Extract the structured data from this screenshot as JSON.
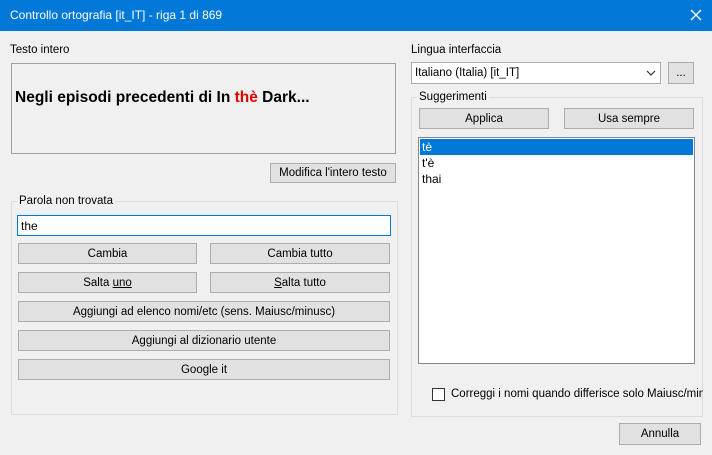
{
  "window": {
    "title": "Controllo ortografia [it_IT] - riga 1 di 869"
  },
  "full_text": {
    "label": "Testo intero",
    "before": "Negli episodi precedenti di In ",
    "error_word": "thè",
    "after": " Dark..."
  },
  "edit_full_text_label": "Modifica l'intero testo",
  "interface_language": {
    "label": "Lingua interfaccia",
    "selected": "Italiano (Italia) [it_IT]",
    "more_label": "..."
  },
  "suggestions": {
    "group_label": "Suggerimenti",
    "apply_label": "Applica",
    "always_use_label": "Usa sempre",
    "items": [
      "tè",
      "t'è",
      "thai"
    ]
  },
  "not_found": {
    "group_label": "Parola non trovata",
    "word_value": "the",
    "change_label": "Cambia",
    "change_all_label": "Cambia tutto",
    "skip_one_pre": "Salta ",
    "skip_one_u": "uno",
    "skip_all_u": "S",
    "skip_all_post": "alta tutto",
    "add_names_label": "Aggiungi ad elenco nomi/etc (sens. Maiusc/minusc)",
    "add_dictionary_label": "Aggiungi al dizionario utente",
    "google_label": "Google it"
  },
  "case_check_label": "Correggi i nomi quando differisce solo Maiusc/minusc",
  "cancel_label": "Annulla",
  "colors": {
    "titlebar": "#0078d7",
    "error_word": "#e00000",
    "selection": "#0078d7"
  }
}
